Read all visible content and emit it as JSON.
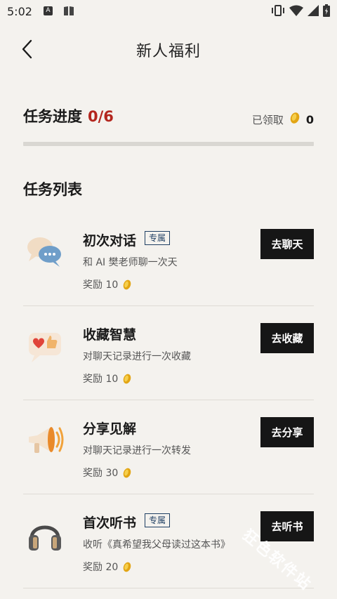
{
  "status_bar": {
    "time": "5:02"
  },
  "header": {
    "title": "新人福利"
  },
  "progress": {
    "label": "任务进度",
    "value_text": "0/6",
    "completed": 0,
    "total": 6,
    "claimed_label": "已领取",
    "claimed_value": "0"
  },
  "list": {
    "title": "任务列表",
    "tasks": [
      {
        "name": "初次对话",
        "badge": "专属",
        "desc": "和 AI 樊老师聊一次天",
        "reward": "奖励 10",
        "button": "去聊天",
        "icon": "chat-bubbles-icon"
      },
      {
        "name": "收藏智慧",
        "badge": "",
        "desc": "对聊天记录进行一次收藏",
        "reward": "奖励 10",
        "button": "去收藏",
        "icon": "heart-thumbs-up-icon"
      },
      {
        "name": "分享见解",
        "badge": "",
        "desc": "对聊天记录进行一次转发",
        "reward": "奖励 30",
        "button": "去分享",
        "icon": "megaphone-icon"
      },
      {
        "name": "首次听书",
        "badge": "专属",
        "desc": "收听《真希望我父母读过这本书》",
        "reward": "奖励 20",
        "button": "去听书",
        "icon": "headphones-icon"
      }
    ]
  },
  "colors": {
    "accent_red": "#b3261e",
    "button_bg": "#161616",
    "badge_blue": "#1f3f63",
    "background": "#f4f2ee"
  },
  "watermark": "狂色软件站"
}
